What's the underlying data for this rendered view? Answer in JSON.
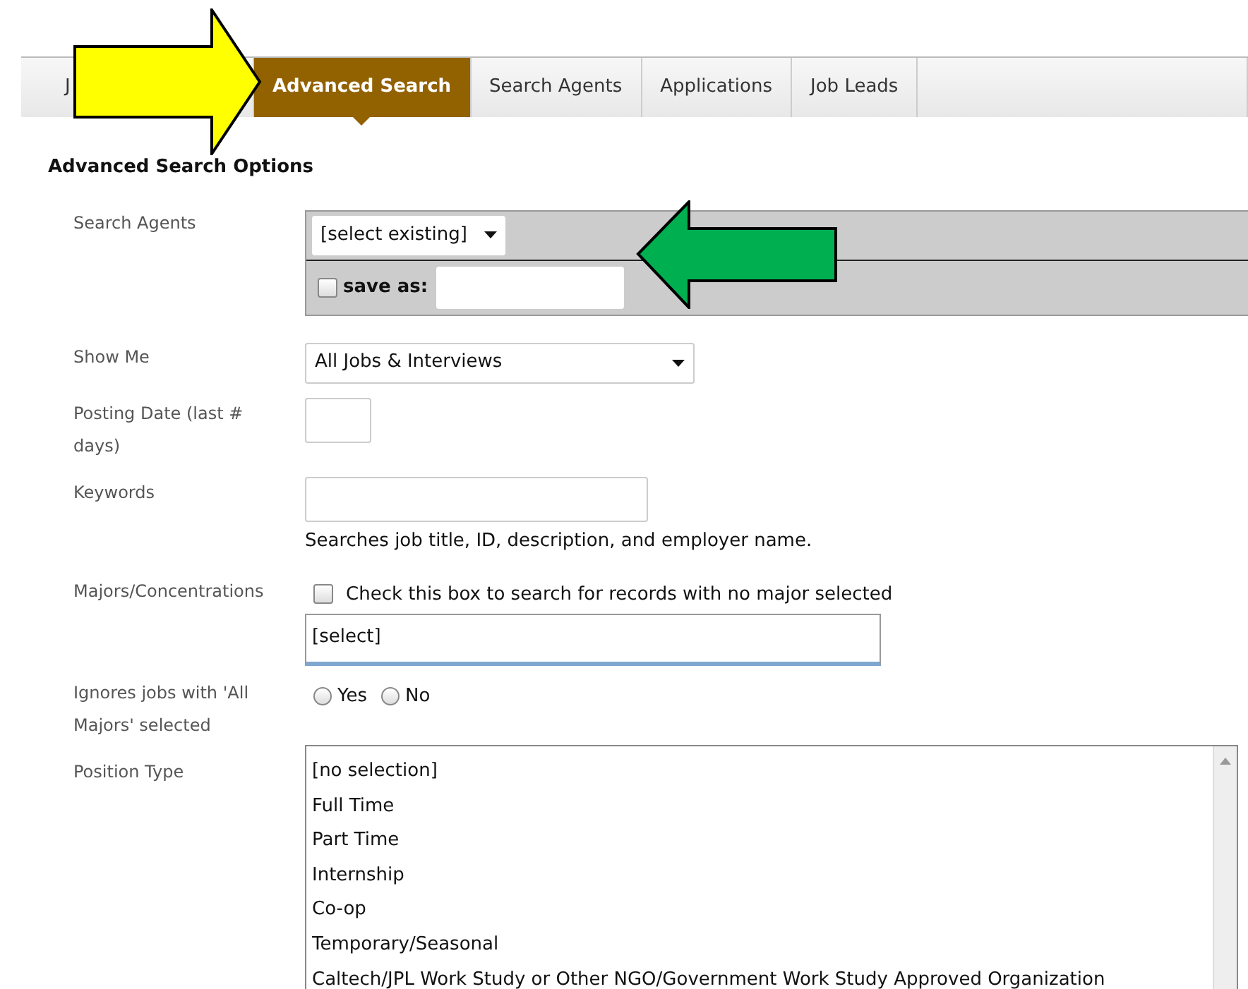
{
  "tabs": [
    {
      "label": "J",
      "selected": false
    },
    {
      "label": "Advanced Search",
      "selected": true
    },
    {
      "label": "Search Agents",
      "selected": false
    },
    {
      "label": "Applications",
      "selected": false
    },
    {
      "label": "Job Leads",
      "selected": false
    }
  ],
  "heading": "Advanced Search Options",
  "fields": [
    {
      "kind": "agent",
      "label": "Search Agents",
      "value": "[select existing]",
      "save_label": "save as:",
      "save_checked": false
    },
    {
      "kind": "select",
      "label": "Show Me",
      "value": "All Jobs & Interviews"
    },
    {
      "kind": "short_text",
      "label": "Posting Date (last # days)"
    },
    {
      "kind": "text",
      "label": "Keywords",
      "help": "Searches job title, ID, description, and employer name."
    },
    {
      "kind": "majors",
      "label": "Majors/Concentrations",
      "check_label": "Check this box to search for records with no major selected",
      "checked": false,
      "value": "[select]"
    },
    {
      "kind": "radio",
      "label": "Ignores jobs with 'All Majors' selected",
      "options": [
        {
          "label": "Yes",
          "selected": false
        },
        {
          "label": "No",
          "selected": false
        }
      ]
    },
    {
      "kind": "listbox",
      "label": "Position Type",
      "options": [
        {
          "label": "[no selection]",
          "selected": false
        },
        {
          "label": "Full Time",
          "selected": false
        },
        {
          "label": "Part Time",
          "selected": false
        },
        {
          "label": "Internship",
          "selected": false
        },
        {
          "label": "Co-op",
          "selected": false
        },
        {
          "label": "Temporary/Seasonal",
          "selected": false
        },
        {
          "label": "Caltech/JPL Work Study or Other NGO/Government Work Study Approved Organization",
          "selected": false
        }
      ]
    }
  ],
  "annotations": [
    {
      "kind": "right",
      "color": "#ffff00"
    },
    {
      "kind": "left",
      "color": "#00b050"
    }
  ]
}
